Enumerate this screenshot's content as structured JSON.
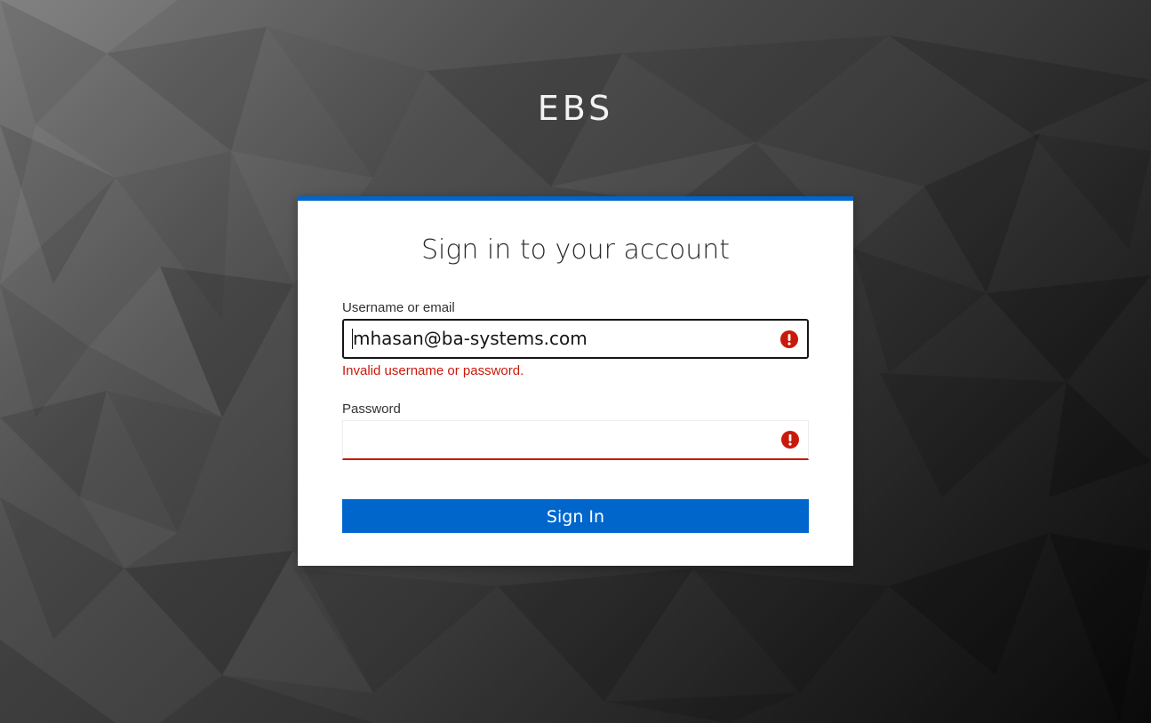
{
  "brand": {
    "title": "EBS"
  },
  "login": {
    "heading": "Sign in to your account",
    "username": {
      "label": "Username or email",
      "value": "mhasan@ba-systems.com",
      "state": "error-focused"
    },
    "error_message": "Invalid username or password.",
    "password": {
      "label": "Password",
      "value": "",
      "state": "error"
    },
    "submit_label": "Sign In"
  },
  "colors": {
    "accent": "#0066cc",
    "error": "#c9190b",
    "card_bg": "#ffffff"
  },
  "icons": {
    "error": "exclamation-circle-icon"
  }
}
